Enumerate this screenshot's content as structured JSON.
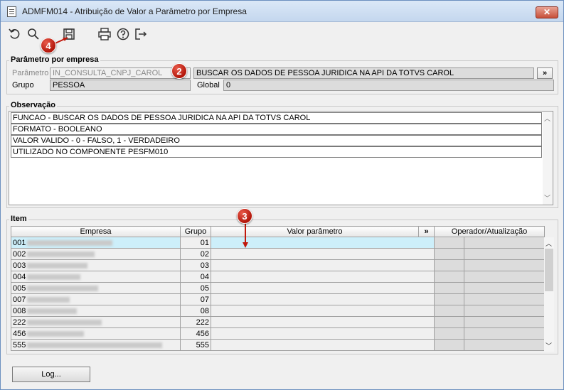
{
  "window": {
    "title": "ADMFM014 - Atribuição de Valor a Parâmetro por Empresa",
    "close_label": "✕"
  },
  "toolbar": {
    "icons": [
      "undo-icon",
      "search-icon",
      "save-icon",
      "print-icon",
      "help-icon",
      "exit-icon"
    ]
  },
  "markers": {
    "m2": "2",
    "m3": "3",
    "m4": "4"
  },
  "param_group": {
    "title": "Parâmetro por empresa",
    "param_label": "Parâmetro",
    "param_value": "IN_CONSULTA_CNPJ_CAROL",
    "param_desc": "BUSCAR OS DADOS DE PESSOA JURIDICA NA API DA TOTVS CAROL",
    "expand_label": "»",
    "group_label": "Grupo",
    "group_value": "PESSOA",
    "global_label": "Global",
    "global_value": "0"
  },
  "obs_group": {
    "title": "Observação",
    "lines": [
      "FUNCAO - BUSCAR OS DADOS DE PESSOA JURIDICA NA API DA TOTVS CAROL",
      "FORMATO - BOOLEANO",
      "VALOR VALIDO - 0 - FALSO, 1 - VERDADEIRO",
      "UTILIZADO NO COMPONENTE PESFM010"
    ]
  },
  "item_group": {
    "title": "Item",
    "headers": {
      "empresa": "Empresa",
      "grupo": "Grupo",
      "valor": "Valor parâmetro",
      "expand": "»",
      "operador": "Operador/Atualização"
    },
    "rows": [
      {
        "code": "001",
        "grupo": "01"
      },
      {
        "code": "002",
        "grupo": "02"
      },
      {
        "code": "003",
        "grupo": "03"
      },
      {
        "code": "004",
        "grupo": "04"
      },
      {
        "code": "005",
        "grupo": "05"
      },
      {
        "code": "007",
        "grupo": "07"
      },
      {
        "code": "008",
        "grupo": "08"
      },
      {
        "code": "222",
        "grupo": "222"
      },
      {
        "code": "456",
        "grupo": "456"
      },
      {
        "code": "555",
        "grupo": "555"
      }
    ]
  },
  "footer": {
    "log_label": "Log..."
  }
}
